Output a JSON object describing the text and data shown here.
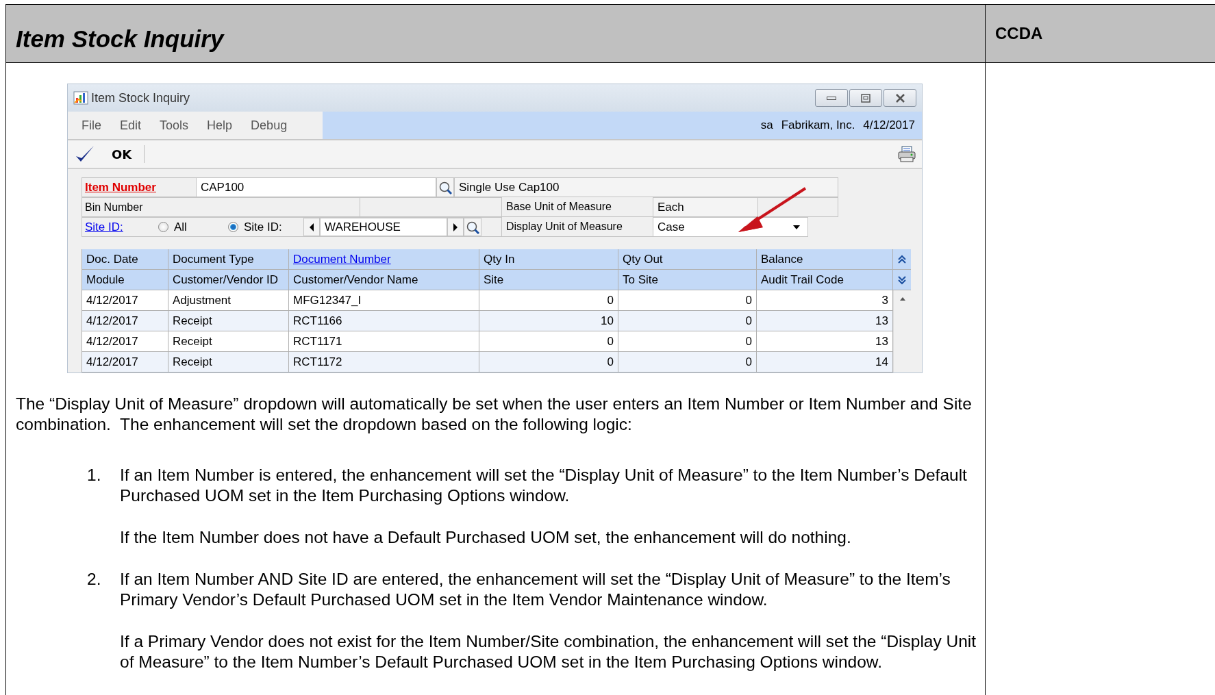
{
  "page": {
    "title": "Item Stock Inquiry",
    "side_label": "CCDA"
  },
  "window": {
    "title": "Item Stock Inquiry",
    "menu": [
      "File",
      "Edit",
      "Tools",
      "Help",
      "Debug"
    ],
    "user": "sa",
    "company": "Fabrikam, Inc.",
    "date": "4/12/2017",
    "ok_label": "OK",
    "form": {
      "item_label": "Item Number",
      "item_value": "CAP100",
      "item_description": "Single Use Cap100",
      "bin_label": "Bin Number",
      "site_label": "Site ID:",
      "site_options": [
        {
          "label": "All",
          "selected": false
        },
        {
          "label": "Site ID:",
          "selected": true
        }
      ],
      "site_value": "WAREHOUSE",
      "base_uom_label": "Base Unit of Measure",
      "base_uom_value": "Each",
      "display_uom_label": "Display Unit of Measure",
      "display_uom_value": "Case"
    },
    "grid": {
      "columns": [
        {
          "top": "Doc. Date",
          "bottom": "Module",
          "top_link": false
        },
        {
          "top": "Document Type",
          "bottom": "Customer/Vendor ID",
          "top_link": false
        },
        {
          "top": "Document Number",
          "bottom": "Customer/Vendor Name",
          "top_link": true
        },
        {
          "top": "Qty In",
          "bottom": "Site",
          "top_link": false
        },
        {
          "top": "Qty Out",
          "bottom": "To Site",
          "top_link": false
        },
        {
          "top": "Balance",
          "bottom": "Audit Trail Code",
          "top_link": false
        }
      ],
      "rows": [
        [
          "4/12/2017",
          "Adjustment",
          "MFG12347_I",
          "0",
          "0",
          "3"
        ],
        [
          "4/12/2017",
          "Receipt",
          "RCT1166",
          "10",
          "0",
          "13"
        ],
        [
          "4/12/2017",
          "Receipt",
          "RCT1171",
          "0",
          "0",
          "13"
        ],
        [
          "4/12/2017",
          "Receipt",
          "RCT1172",
          "0",
          "0",
          "14"
        ]
      ]
    }
  },
  "body": {
    "intro": "The “Display Unit of Measure” dropdown will automatically be set when the user enters an Item Number or Item Number and Site combination.  The enhancement will set the dropdown based on the following logic:",
    "list": [
      {
        "number": "1.",
        "paragraphs": [
          "If an Item Number is entered, the enhancement will set the “Display Unit of Measure” to the Item Number’s Default Purchased UOM set in the Item Purchasing Options window.",
          "If the Item Number does not have a Default Purchased UOM set, the enhancement will do nothing."
        ]
      },
      {
        "number": "2.",
        "paragraphs": [
          "If an Item Number AND Site ID are entered, the enhancement will set the “Display Unit of Measure” to the Item’s Primary Vendor’s Default Purchased UOM set in the Item Vendor Maintenance window.",
          "If a Primary Vendor does not exist for the Item Number/Site combination, the enhancement will set the “Display Unit of Measure” to the Item Number’s Default Purchased UOM set in the Item Purchasing Options window."
        ]
      }
    ]
  }
}
